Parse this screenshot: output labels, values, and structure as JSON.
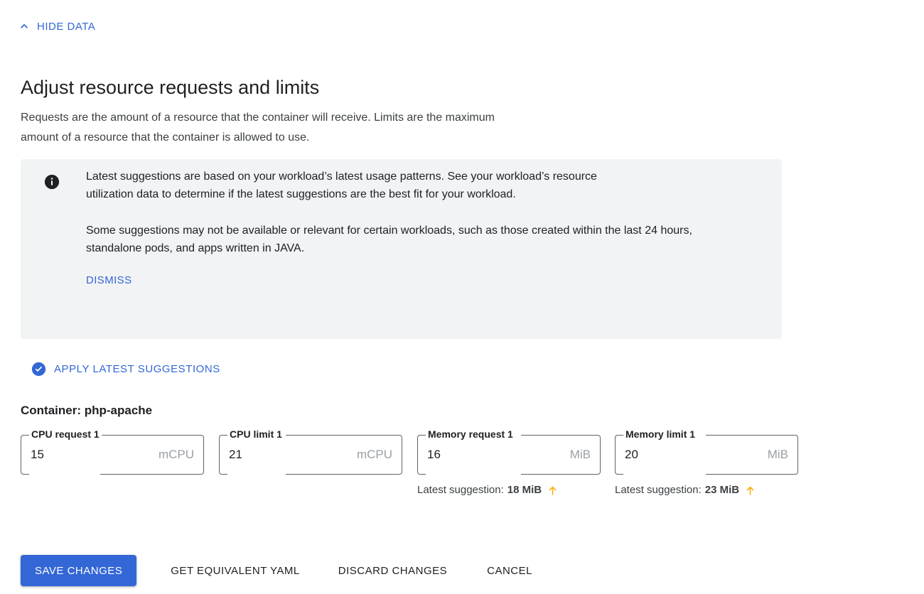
{
  "toggle": {
    "label": "HIDE DATA",
    "icon": "chevron-up-icon",
    "color": "#3367d6"
  },
  "section": {
    "title": "Adjust resource requests and limits",
    "description": "Requests are the amount of a resource that the container will receive. Limits are the maximum amount of a resource that the container is allowed to use."
  },
  "info_banner": {
    "icon": "info-icon",
    "background": "#f1f3f4",
    "paragraph_1": "Latest suggestions are based on your workload’s latest usage patterns. See your workload’s resource utilization data to determine if the latest suggestions are the best fit for your workload.",
    "paragraph_2": "Some suggestions may not be available or relevant for certain workloads, such as those created within the last 24 hours, standalone pods, and apps written in JAVA.",
    "dismiss_label": "DISMISS"
  },
  "apply_suggestions": {
    "label": "APPLY LATEST SUGGESTIONS",
    "icon": "check-circle-icon",
    "color": "#3367d6"
  },
  "container": {
    "heading": "Container: php-apache"
  },
  "fields": [
    {
      "label": "CPU request 1",
      "value": "15",
      "suffix": "mCPU",
      "help_prefix": "",
      "help_value": "",
      "has_help": false
    },
    {
      "label": "CPU limit 1",
      "value": "21",
      "suffix": "mCPU",
      "help_prefix": "",
      "help_value": "",
      "has_help": false
    },
    {
      "label": "Memory request 1",
      "value": "16",
      "suffix": "MiB",
      "help_prefix": "Latest suggestion:",
      "help_value": "18 MiB",
      "has_help": true,
      "help_icon": "arrow-up-icon",
      "help_icon_color": "#f9ab00"
    },
    {
      "label": "Memory limit 1",
      "value": "20",
      "suffix": "MiB",
      "help_prefix": "Latest suggestion:",
      "help_value": "23 MiB",
      "has_help": true,
      "help_icon": "arrow-up-icon",
      "help_icon_color": "#f9ab00"
    }
  ],
  "actions": {
    "save": "SAVE CHANGES",
    "yaml": "GET EQUIVALENT YAML",
    "discard": "DISCARD CHANGES",
    "cancel": "CANCEL",
    "primary_color": "#3367d6"
  }
}
